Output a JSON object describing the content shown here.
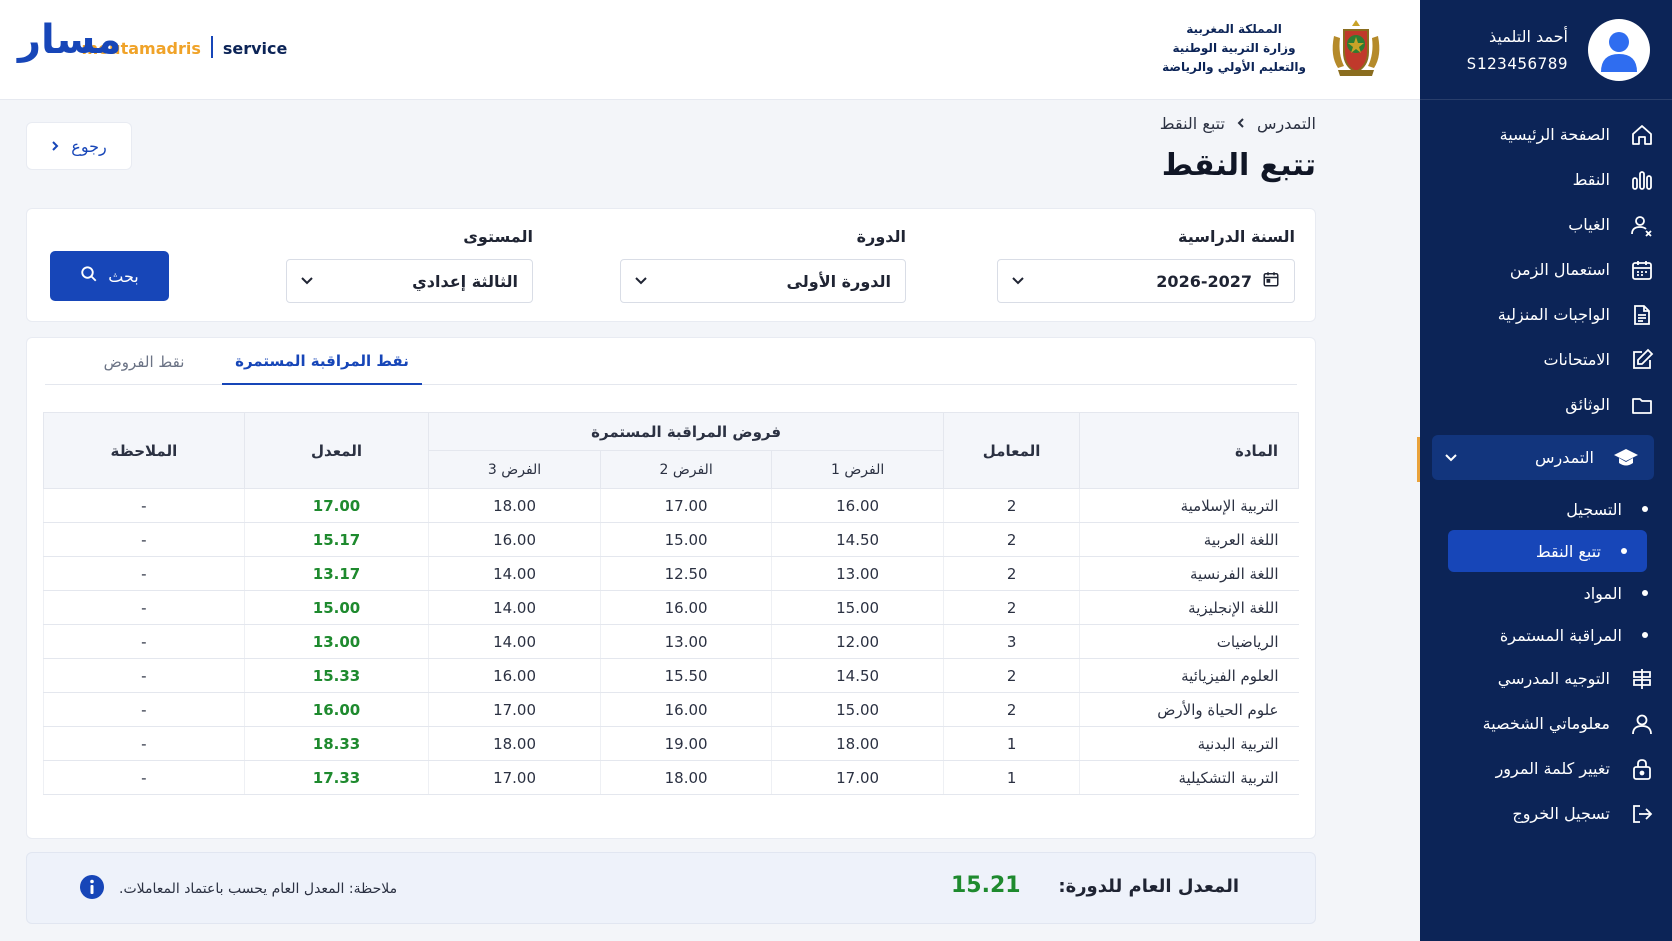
{
  "profile": {
    "name": "أحمد التلميذ",
    "id": "S123456789"
  },
  "brand": {
    "arabic": "مسار",
    "latin": "moutamadris",
    "service": "service"
  },
  "ministry": {
    "line1": "المملكة المغربية",
    "line2": "وزارة التربية الوطنية",
    "line3": "والتعليم الأولي والرياضة"
  },
  "sidebar": {
    "items": [
      {
        "label": "الصفحة الرئيسية",
        "icon": "home-icon"
      },
      {
        "label": "النقط",
        "icon": "bar-chart-icon"
      },
      {
        "label": "الغياب",
        "icon": "user-x-icon"
      },
      {
        "label": "استعمال الزمن",
        "icon": "calendar-icon"
      },
      {
        "label": "الواجبات المنزلية",
        "icon": "document-icon"
      },
      {
        "label": "الامتحانات",
        "icon": "edit-icon"
      },
      {
        "label": "الوثائق",
        "icon": "folder-icon"
      }
    ],
    "expanded": {
      "label": "التمدرس",
      "icon": "graduation-cap-icon"
    },
    "sub_items": [
      {
        "label": "التسجيل"
      },
      {
        "label": "تتبع النقط"
      },
      {
        "label": "المواد"
      },
      {
        "label": "المراقبة المستمرة"
      }
    ],
    "bottom_items": [
      {
        "label": "التوجيه المدرسي",
        "icon": "signpost-icon"
      },
      {
        "label": "معلوماتي الشخصية",
        "icon": "user-icon"
      },
      {
        "label": "تغيير كلمة المرور",
        "icon": "lock-icon"
      },
      {
        "label": "تسجيل الخروج",
        "icon": "logout-icon"
      }
    ]
  },
  "back_label": "رجوع",
  "breadcrumb": {
    "parent": "التمدرس",
    "current": "تتبع النقط"
  },
  "page_title": "تتبع النقط",
  "filters": {
    "year_label": "السنة الدراسية",
    "year_value": "2026-2027",
    "session_label": "الدورة",
    "session_value": "الدورة الأولى",
    "level_label": "المستوى",
    "level_value": "الثالثة إعدادي",
    "search_label": "بحث"
  },
  "tabs": {
    "active": "نقط المراقبة المستمرة",
    "inactive": "نقط الفروض"
  },
  "table": {
    "headers": {
      "subject": "المادة",
      "coef": "المعامل",
      "group": "فروض المراقبة المستمرة",
      "exam1": "الفرض 1",
      "exam2": "الفرض 2",
      "exam3": "الفرض 3",
      "average": "المعدل",
      "remark": "الملاحظة"
    },
    "rows": [
      {
        "subject": "التربية الإسلامية",
        "coef": "2",
        "e1": "16.00",
        "e2": "17.00",
        "e3": "18.00",
        "avg": "17.00",
        "remark": "-"
      },
      {
        "subject": "اللغة العربية",
        "coef": "2",
        "e1": "14.50",
        "e2": "15.00",
        "e3": "16.00",
        "avg": "15.17",
        "remark": "-"
      },
      {
        "subject": "اللغة الفرنسية",
        "coef": "2",
        "e1": "13.00",
        "e2": "12.50",
        "e3": "14.00",
        "avg": "13.17",
        "remark": "-"
      },
      {
        "subject": "اللغة الإنجليزية",
        "coef": "2",
        "e1": "15.00",
        "e2": "16.00",
        "e3": "14.00",
        "avg": "15.00",
        "remark": "-"
      },
      {
        "subject": "الرياضيات",
        "coef": "3",
        "e1": "12.00",
        "e2": "13.00",
        "e3": "14.00",
        "avg": "13.00",
        "remark": "-"
      },
      {
        "subject": "العلوم الفيزيائية",
        "coef": "2",
        "e1": "14.50",
        "e2": "15.50",
        "e3": "16.00",
        "avg": "15.33",
        "remark": "-"
      },
      {
        "subject": "علوم الحياة والأرض",
        "coef": "2",
        "e1": "15.00",
        "e2": "16.00",
        "e3": "17.00",
        "avg": "16.00",
        "remark": "-"
      },
      {
        "subject": "التربية البدنية",
        "coef": "1",
        "e1": "18.00",
        "e2": "19.00",
        "e3": "18.00",
        "avg": "18.33",
        "remark": "-"
      },
      {
        "subject": "التربية التشكيلية",
        "coef": "1",
        "e1": "17.00",
        "e2": "18.00",
        "e3": "17.00",
        "avg": "17.33",
        "remark": "-"
      }
    ]
  },
  "summary": {
    "overall_label": "المعدل العام للدورة:",
    "overall_value": "15.21",
    "note": "ملاحظة: المعدل العام يحسب باعتماد المعاملات."
  },
  "colors": {
    "navy": "#0c2457",
    "primary": "#1746b8",
    "accent": "#f0a329",
    "success": "#1e8a2e"
  }
}
